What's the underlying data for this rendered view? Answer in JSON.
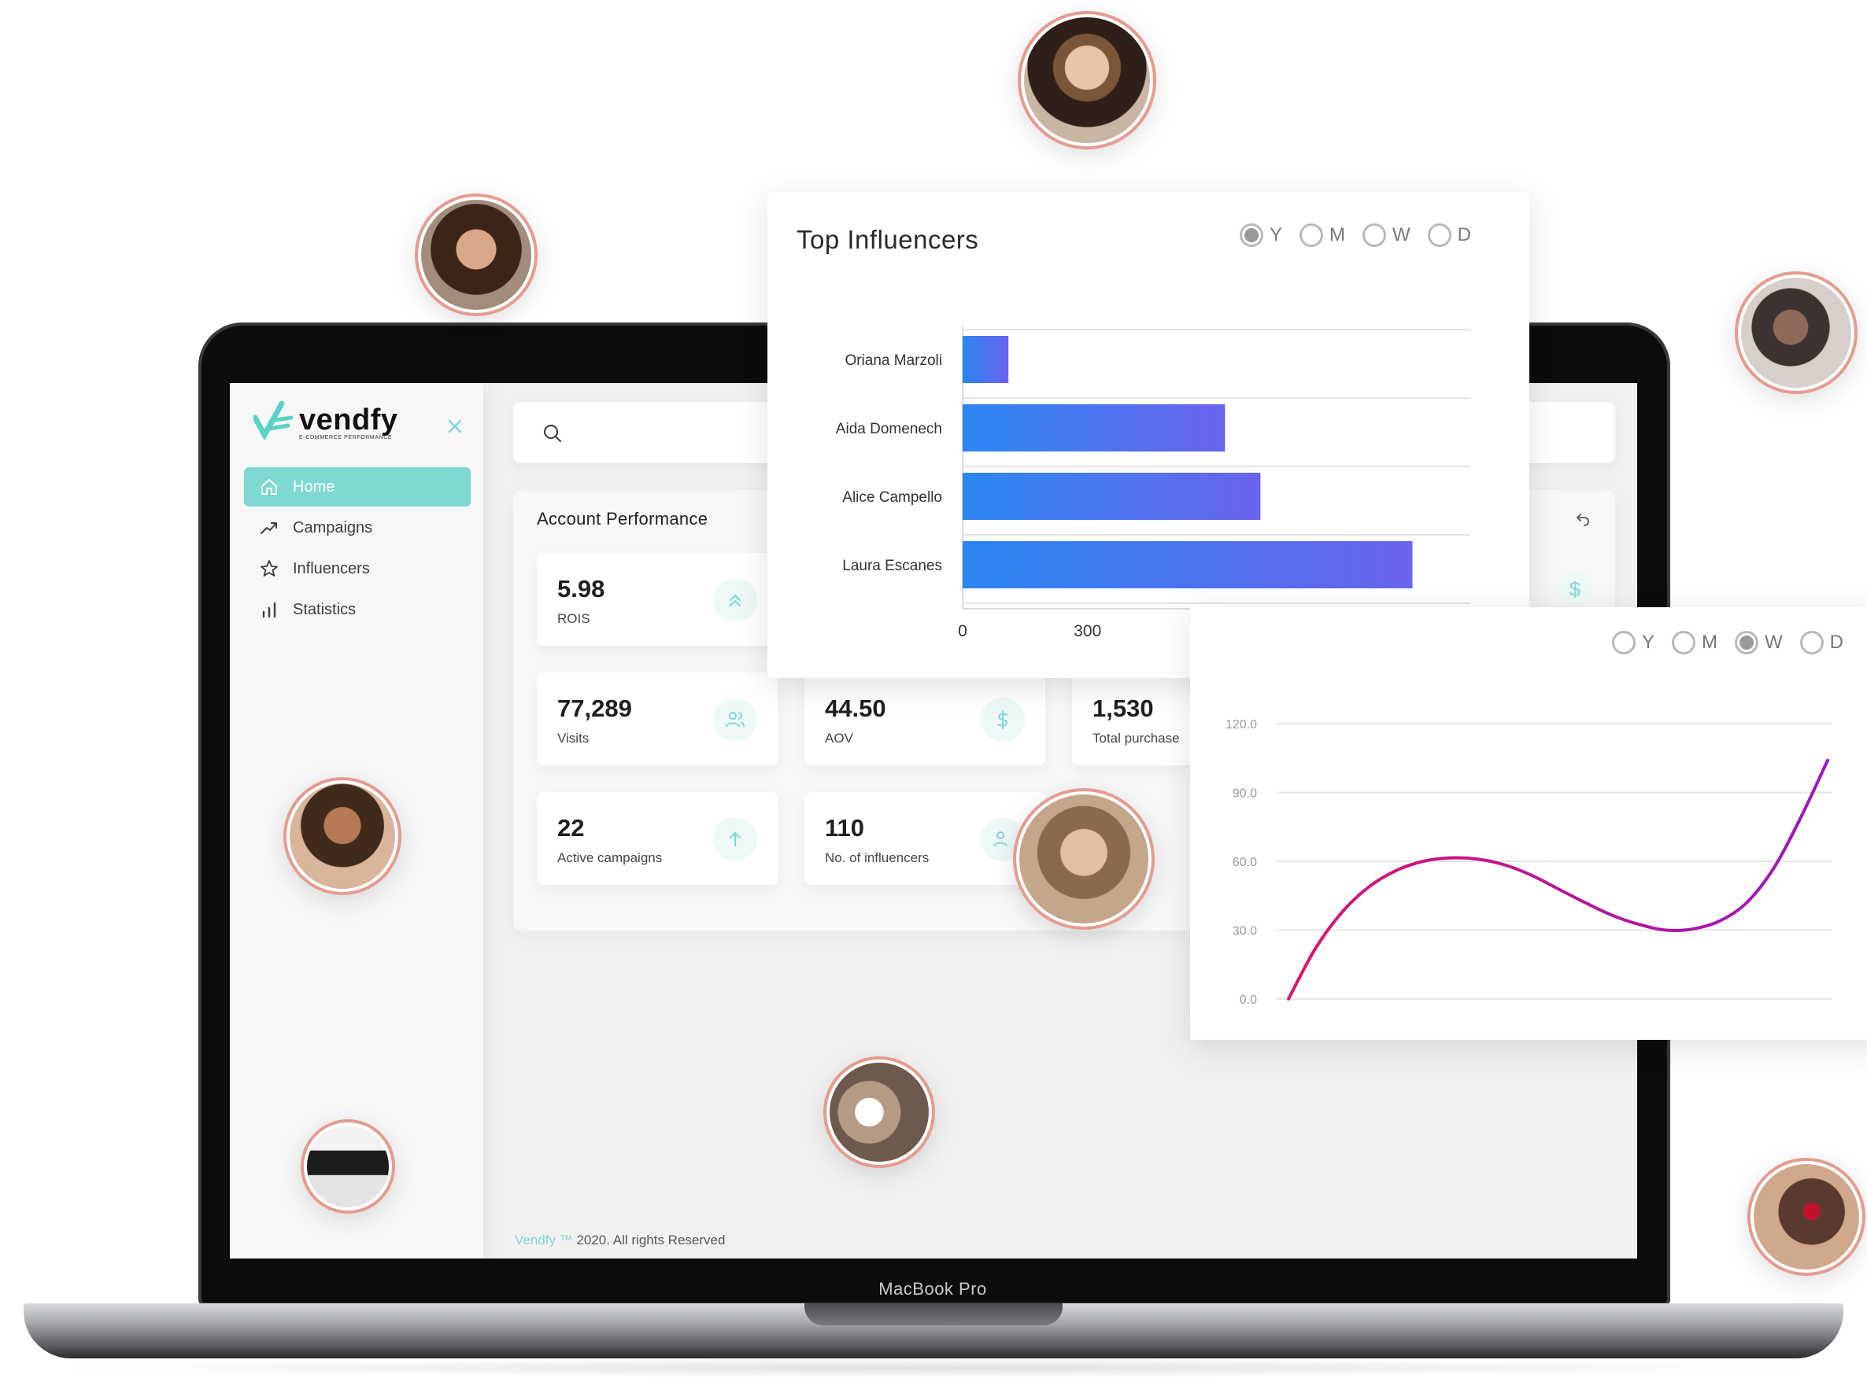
{
  "brand": {
    "name": "vendfy",
    "tagline": "E-COMMERCE PERFORMANCE",
    "trademark": "™",
    "accent_color": "#7fd9d0"
  },
  "sidebar": {
    "items": [
      {
        "label": "Home",
        "icon": "home-icon",
        "active": true
      },
      {
        "label": "Campaigns",
        "icon": "trend-icon",
        "active": false
      },
      {
        "label": "Influencers",
        "icon": "star-icon",
        "active": false
      },
      {
        "label": "Statistics",
        "icon": "bar-chart-icon",
        "active": false
      }
    ]
  },
  "account_performance": {
    "title": "Account Performance",
    "metrics": [
      {
        "value": "5.98",
        "label": "ROIS",
        "icon": "double-chevron-up-icon"
      },
      {
        "value": "77,289",
        "label": "Visits",
        "icon": "users-icon"
      },
      {
        "value": "44.50",
        "label": "AOV",
        "icon": "dollar-icon"
      },
      {
        "value": "1,530",
        "label": "Total purchase",
        "icon": ""
      },
      {
        "value": "22",
        "label": "Active campaigns",
        "icon": "arrow-up-icon"
      },
      {
        "value": "110",
        "label": "No. of influencers",
        "icon": "users-icon"
      }
    ]
  },
  "footer": {
    "brand": "Vendfy ™",
    "text": " 2020. All rights Reserved"
  },
  "top_influencers": {
    "title": "Top Influencers",
    "periods": [
      {
        "label": "Y",
        "selected": true
      },
      {
        "label": "M",
        "selected": false
      },
      {
        "label": "W",
        "selected": false
      },
      {
        "label": "D",
        "selected": false
      }
    ]
  },
  "trend_card": {
    "periods": [
      {
        "label": "Y",
        "selected": false
      },
      {
        "label": "M",
        "selected": false
      },
      {
        "label": "W",
        "selected": true
      },
      {
        "label": "D",
        "selected": false
      }
    ]
  },
  "laptop": {
    "label": "MacBook Pro"
  },
  "chart_data": [
    {
      "type": "bar",
      "orientation": "horizontal",
      "title": "Top Influencers",
      "categories": [
        "Oriana Marzoli",
        "Aida Domenech",
        "Alice Campello",
        "Laura Escanes"
      ],
      "values": [
        110,
        630,
        715,
        1080
      ],
      "xlim": [
        0,
        1200
      ],
      "xticks": [
        "0",
        "300",
        "600",
        "900",
        "1200"
      ],
      "grid": true,
      "colors": {
        "start": "#2b86f2",
        "end": "#6a63ee"
      }
    },
    {
      "type": "line",
      "ylim": [
        0,
        120
      ],
      "yticks": [
        "0.0",
        "30.0",
        "60.0",
        "90.0",
        "120.0"
      ],
      "x": [
        0,
        0.05,
        0.1,
        0.15,
        0.2,
        0.25,
        0.3,
        0.35,
        0.4,
        0.45,
        0.5,
        0.55,
        0.6,
        0.65,
        0.7,
        0.75,
        0.8,
        0.85,
        0.9,
        0.95,
        1.0
      ],
      "values": [
        0,
        22,
        38,
        49,
        56,
        60,
        61.5,
        61,
        58.5,
        54,
        48,
        42,
        36.5,
        32.5,
        30,
        30.5,
        34,
        42,
        57,
        79,
        104
      ],
      "grid": true,
      "color": "#9b16c0",
      "color_start": "#d9156d"
    }
  ]
}
